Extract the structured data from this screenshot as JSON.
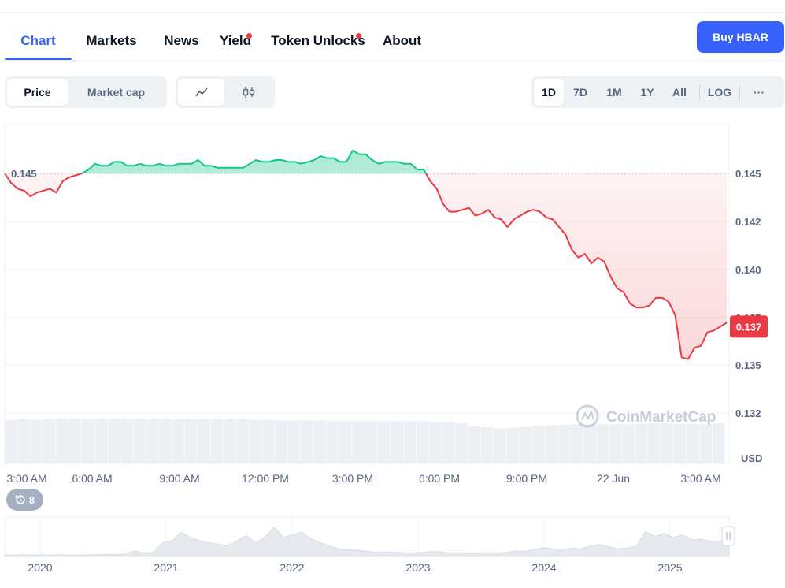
{
  "tabs": [
    {
      "label": "Chart",
      "active": true,
      "dot": false
    },
    {
      "label": "Markets",
      "active": false,
      "dot": false
    },
    {
      "label": "News",
      "active": false,
      "dot": false
    },
    {
      "label": "Yield",
      "active": false,
      "dot": true
    },
    {
      "label": "Token Unlocks",
      "active": false,
      "dot": true
    },
    {
      "label": "About",
      "active": false,
      "dot": false
    }
  ],
  "buy_button": "Buy HBAR",
  "metric_toggle": {
    "options": [
      "Price",
      "Market cap"
    ],
    "selected": "Price"
  },
  "chart_type_toggle": {
    "options": [
      "line-chart-icon",
      "candlestick-icon"
    ],
    "selected": "line-chart-icon"
  },
  "ranges": {
    "options": [
      "1D",
      "7D",
      "1M",
      "1Y",
      "All"
    ],
    "selected": "1D",
    "log_label": "LOG",
    "more_label": "···"
  },
  "history_badge": "8",
  "watermark": "CoinMarketCap",
  "colors": {
    "up": "#16c784",
    "down": "#ea3943",
    "accent": "#3861fb"
  },
  "chart_data": {
    "type": "line",
    "currency_label": "USD",
    "reference_price": 0.145,
    "current_price": 0.137,
    "y_ticks": [
      "0.145",
      "0.142",
      "0.140",
      "0.137",
      "0.135",
      "0.132"
    ],
    "x_labels": [
      "3:00 AM",
      "6:00 AM",
      "9:00 AM",
      "12:00 PM",
      "3:00 PM",
      "6:00 PM",
      "9:00 PM",
      "22 Jun",
      "3:00 AM"
    ],
    "series": [
      {
        "values": [
          0.145,
          0.1445,
          0.1442,
          0.1441,
          0.1438,
          0.144,
          0.1441,
          0.1442,
          0.144,
          0.1446,
          0.1448,
          0.1449,
          0.145,
          0.1452,
          0.1455,
          0.1454,
          0.1454,
          0.1456,
          0.1456,
          0.1454,
          0.1454,
          0.1455,
          0.1454,
          0.1454,
          0.1455,
          0.1454,
          0.1454,
          0.1455,
          0.1455,
          0.1455,
          0.1457,
          0.1454,
          0.1454,
          0.1453,
          0.1453,
          0.1453,
          0.1453,
          0.1453,
          0.1455,
          0.1457,
          0.1456,
          0.1456,
          0.1457,
          0.1457,
          0.1456,
          0.1456,
          0.1455,
          0.1456,
          0.1457,
          0.1459,
          0.1458,
          0.1458,
          0.1456,
          0.1456,
          0.1462,
          0.146,
          0.146,
          0.1457,
          0.1455,
          0.1456,
          0.1456,
          0.1456,
          0.1455,
          0.1455,
          0.1452,
          0.1452,
          0.1446,
          0.1442,
          0.1434,
          0.143,
          0.143,
          0.1431,
          0.1432,
          0.1428,
          0.1429,
          0.1431,
          0.1427,
          0.1426,
          0.1422,
          0.1426,
          0.1428,
          0.143,
          0.1431,
          0.143,
          0.1427,
          0.1426,
          0.1422,
          0.1418,
          0.141,
          0.1406,
          0.1408,
          0.1403,
          0.1406,
          0.1404,
          0.1396,
          0.139,
          0.1388,
          0.1382,
          0.138,
          0.138,
          0.1381,
          0.1385,
          0.1385,
          0.1383,
          0.1376,
          0.1354,
          0.1353,
          0.1359,
          0.136,
          0.1367,
          0.1368,
          0.137,
          0.1372
        ]
      }
    ],
    "volume_series": [
      0.86,
      0.88,
      0.87,
      0.88,
      0.88,
      0.88,
      0.89,
      0.88,
      0.88,
      0.89,
      0.89,
      0.88,
      0.88,
      0.88,
      0.89,
      0.88,
      0.88,
      0.88,
      0.88,
      0.87,
      0.87,
      0.86,
      0.86,
      0.86,
      0.86,
      0.85,
      0.85,
      0.85,
      0.85,
      0.84,
      0.84,
      0.84,
      0.84,
      0.83,
      0.82,
      0.8,
      0.74,
      0.72,
      0.7,
      0.71,
      0.73,
      0.75,
      0.76,
      0.77,
      0.78,
      0.78,
      0.78,
      0.78,
      0.78,
      0.79,
      0.8,
      0.8,
      0.79,
      0.79,
      0.78,
      0.8
    ],
    "navigator": {
      "x_labels": [
        "2020",
        "2021",
        "2022",
        "2023",
        "2024",
        "2025"
      ],
      "values": [
        0.04,
        0.04,
        0.05,
        0.04,
        0.05,
        0.04,
        0.05,
        0.04,
        0.04,
        0.05,
        0.05,
        0.06,
        0.05,
        0.08,
        0.16,
        0.1,
        0.12,
        0.4,
        0.45,
        0.7,
        0.55,
        0.45,
        0.4,
        0.35,
        0.3,
        0.45,
        0.6,
        0.4,
        0.55,
        0.85,
        0.55,
        0.62,
        0.7,
        0.5,
        0.4,
        0.3,
        0.22,
        0.2,
        0.18,
        0.15,
        0.12,
        0.13,
        0.12,
        0.11,
        0.1,
        0.12,
        0.14,
        0.13,
        0.1,
        0.11,
        0.1,
        0.1,
        0.11,
        0.1,
        0.12,
        0.16,
        0.14,
        0.2,
        0.26,
        0.22,
        0.2,
        0.24,
        0.22,
        0.3,
        0.35,
        0.28,
        0.22,
        0.24,
        0.3,
        0.72,
        0.58,
        0.66,
        0.55,
        0.62,
        0.48,
        0.5,
        0.44,
        0.45,
        0.48
      ],
      "year_ticks": [
        51,
        211,
        371,
        531,
        691,
        851
      ]
    },
    "grid": true,
    "legend": "none"
  }
}
